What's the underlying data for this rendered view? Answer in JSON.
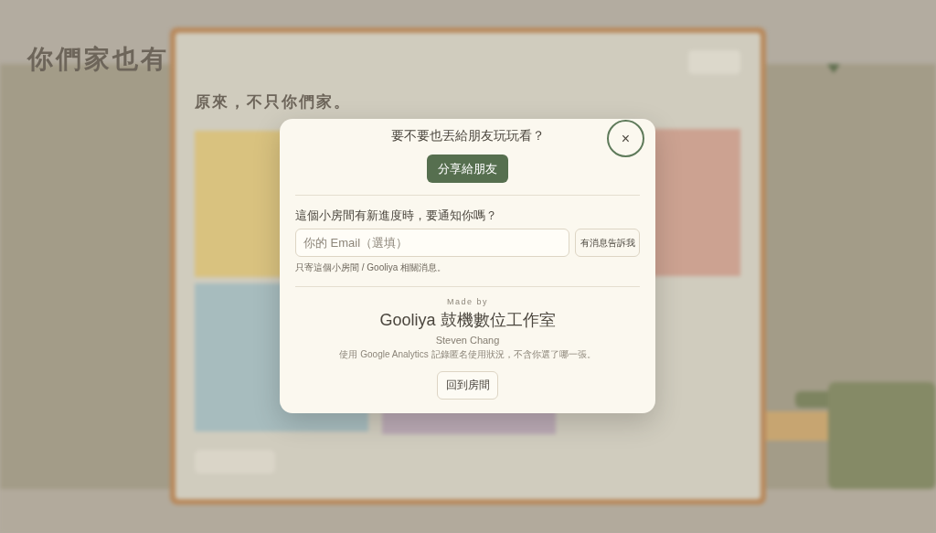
{
  "background": {
    "heading": "你們家也有",
    "section_title": "原來，不只你們家。"
  },
  "dialog": {
    "share_title": "要不要也丟給朋友玩玩看？",
    "share_button": "分享給朋友",
    "close_label": "×",
    "notify_question": "這個小房間有新進度時，要通知你嗎？",
    "email_placeholder": "你的 Email（選填）",
    "notify_button": "有消息告訴我",
    "notify_note": "只寄這個小房間 / Gooliya 相關消息。",
    "made_by": "Made by",
    "studio": "Gooliya 鼓機數位工作室",
    "author": "Steven Chang",
    "analytics_note": "使用 Google Analytics 記錄匿名使用狀況，不含你選了哪一張。",
    "back_button": "回到房間"
  }
}
